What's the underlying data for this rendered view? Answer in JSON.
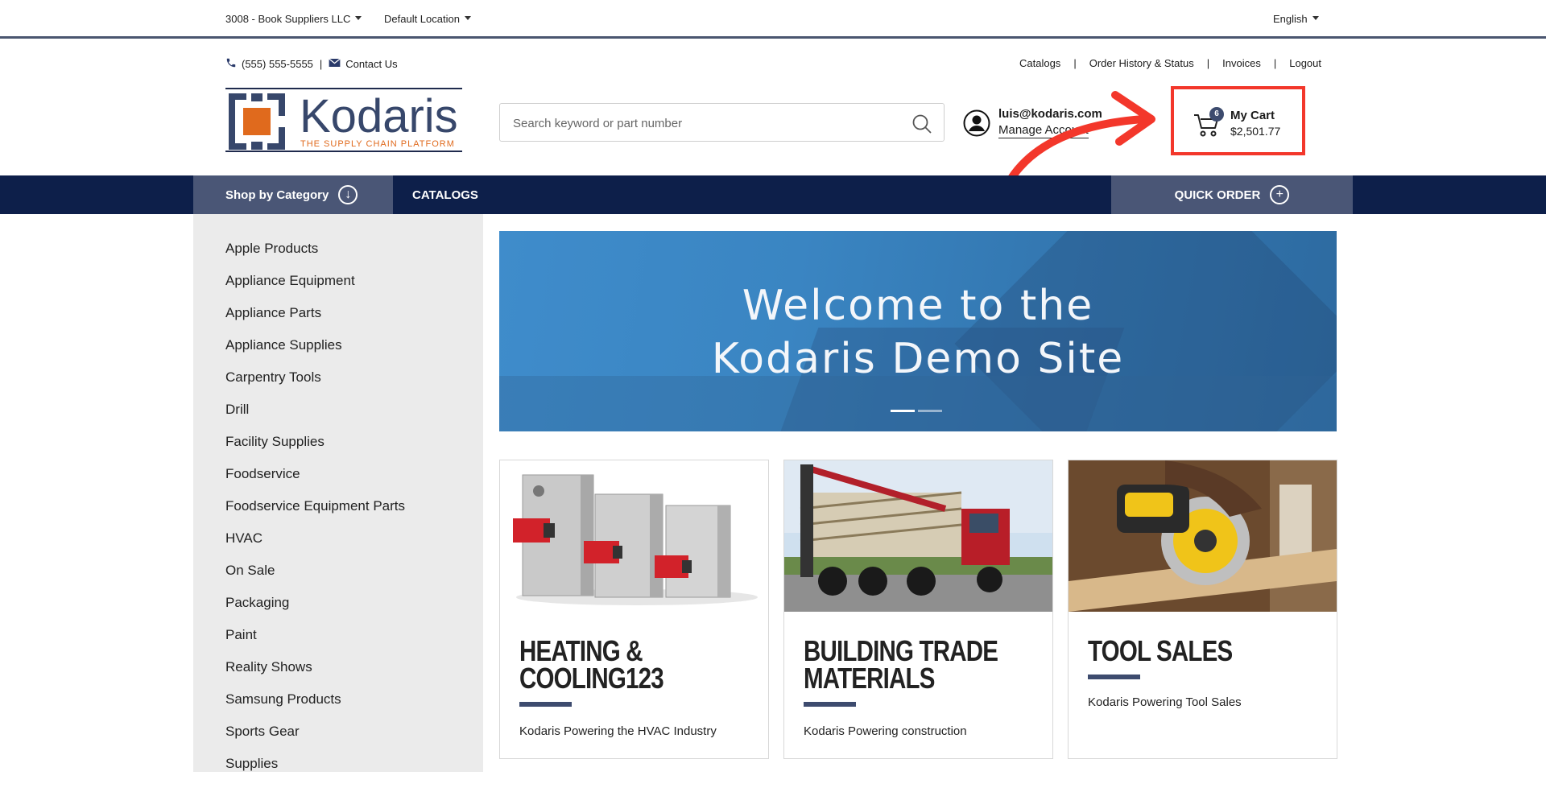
{
  "topbar": {
    "company": "3008 - Book Suppliers LLC",
    "location": "Default Location",
    "language": "English"
  },
  "contact": {
    "phone": "(555) 555-5555",
    "separator": "|",
    "contact_us": "Contact Us"
  },
  "header_links": {
    "catalogs": "Catalogs",
    "order_history": "Order History & Status",
    "invoices": "Invoices",
    "logout": "Logout",
    "separator": "|"
  },
  "logo": {
    "word": "Kodaris",
    "tagline": "THE SUPPLY CHAIN PLATFORM"
  },
  "search": {
    "placeholder": "Search keyword or part number"
  },
  "account": {
    "email": "luis@kodaris.com",
    "manage": "Manage Account"
  },
  "cart": {
    "count": "6",
    "title": "My Cart",
    "total": "$2,501.77"
  },
  "nav": {
    "shop_by_category": "Shop by Category",
    "catalogs": "CATALOGS",
    "quick_order": "QUICK ORDER"
  },
  "sidebar": {
    "items": [
      "Apple Products",
      "Appliance Equipment",
      "Appliance Parts",
      "Appliance Supplies",
      "Carpentry Tools",
      "Drill",
      "Facility Supplies",
      "Foodservice",
      "Foodservice Equipment Parts",
      "HVAC",
      "On Sale",
      "Packaging",
      "Paint",
      "Reality Shows",
      "Samsung Products",
      "Sports Gear",
      "Supplies"
    ]
  },
  "banner": {
    "line1": "Welcome to the",
    "line2": "Kodaris Demo Site",
    "slides": 2,
    "active_slide": 1
  },
  "cards": [
    {
      "title_line1": "HEATING &",
      "title_line2": "COOLING123",
      "desc": "Kodaris Powering the HVAC Industry"
    },
    {
      "title_line1": "BUILDING TRADE",
      "title_line2": "MATERIALS",
      "desc": "Kodaris Powering construction"
    },
    {
      "title_line1": "TOOL SALES",
      "title_line2": "",
      "desc": "Kodaris Powering Tool Sales"
    }
  ],
  "colors": {
    "nav_bg": "#0d1f4a",
    "nav_accent": "#4a5676",
    "highlight": "#f3372b",
    "brand_orange": "#e06a1d",
    "brand_navy": "#37476b"
  }
}
